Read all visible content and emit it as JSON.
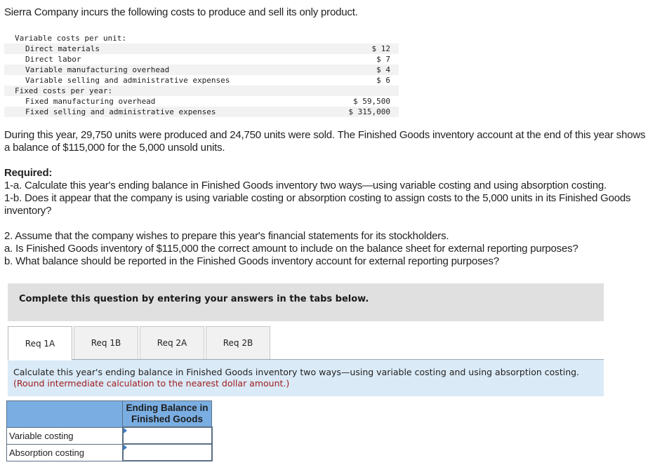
{
  "intro": "Sierra Company incurs the following costs to produce and sell its only product.",
  "cost_table": {
    "variable_header": "Variable costs per unit:",
    "variable_items": [
      {
        "label": "Direct materials",
        "amount": "$ 12"
      },
      {
        "label": "Direct labor",
        "amount": "$ 7"
      },
      {
        "label": "Variable manufacturing overhead",
        "amount": "$ 4"
      },
      {
        "label": "Variable selling and administrative expenses",
        "amount": "$ 6"
      }
    ],
    "fixed_header": "Fixed costs per year:",
    "fixed_items": [
      {
        "label": "Fixed manufacturing overhead",
        "amount": "$ 59,500"
      },
      {
        "label": "Fixed selling and administrative expenses",
        "amount": "$ 315,000"
      }
    ]
  },
  "paragraph1": "During this year, 29,750 units were produced and 24,750 units were sold. The Finished Goods inventory account at the end of this year shows a balance of $115,000 for the 5,000 unsold units.",
  "required_label": "Required:",
  "req_1a": "1-a. Calculate this year's ending balance in Finished Goods inventory two ways—using variable costing and using absorption costing.",
  "req_1b": "1-b. Does it appear that the company is using variable costing or absorption costing to assign costs to the 5,000 units in its Finished Goods inventory?",
  "req_2": "2. Assume that the company wishes to prepare this year's financial statements for its stockholders.",
  "req_2a": "a. Is Finished Goods inventory of $115,000 the correct amount to include on the balance sheet for external reporting purposes?",
  "req_2b": "b. What balance should be reported in the Finished Goods inventory account for external reporting purposes?",
  "complete_bar": "Complete this question by entering your answers in the tabs below.",
  "tabs": [
    {
      "label": "Req 1A",
      "active": true
    },
    {
      "label": "Req 1B",
      "active": false
    },
    {
      "label": "Req 2A",
      "active": false
    },
    {
      "label": "Req 2B",
      "active": false
    }
  ],
  "instructions": {
    "text": "Calculate this year's ending balance in Finished Goods inventory two ways—using variable costing and using absorption costing.",
    "note": "(Round intermediate calculation to the nearest dollar amount.)"
  },
  "answer_table": {
    "column_header": "Ending Balance in Finished Goods",
    "rows": [
      {
        "label": "Variable costing",
        "value": ""
      },
      {
        "label": "Absorption costing",
        "value": ""
      }
    ]
  },
  "colors": {
    "table_header": "#7aaee3",
    "instructions_bg": "#daeaf7",
    "note_text": "#a11c1c",
    "complete_bar_bg": "#e0e0e0"
  }
}
